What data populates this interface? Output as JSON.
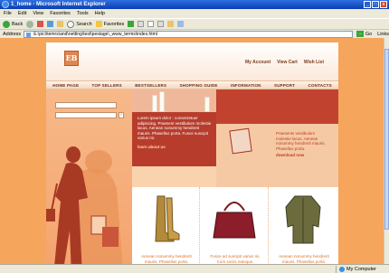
{
  "window": {
    "title": "1_home - Microsoft Internet Explorer",
    "controls": [
      "_",
      "□",
      "x"
    ]
  },
  "menubar": [
    "File",
    "Edit",
    "View",
    "Favorites",
    "Tools",
    "Help"
  ],
  "toolbar": {
    "back_label": "Back",
    "search_label": "Search",
    "favorites_label": "Favorites"
  },
  "address": {
    "label": "Address",
    "url": "E:\\pic\\itemrs\\and\\netting\\test\\pestage\\_www_terms\\index.html",
    "go_label": "Go",
    "links_label": "Links"
  },
  "status": {
    "left": "",
    "zone": "My Computer"
  },
  "site": {
    "logo": "EB",
    "toplinks": [
      "My Account",
      "View Cart",
      "Wish List"
    ],
    "nav": [
      "HOME PAGE",
      "TOP SELLERS",
      "BESTSELLERS",
      "SHOPPING GUIDE",
      "INFORMATION",
      "SUPPORT",
      "CONTACTS"
    ],
    "hero_text": "Lorem ipsum dolor : consectetuer adipiscing. Praesent vestibulum molestie lacus. Aenean nonummy hendrerit mauris. Phasellus porta. Fusce suscipit varius mi.",
    "hero_more": "learn about us",
    "side_text": "Praesents vestibulum molestie lacus. Aenean nonummy hendrerit mauris. Phasellus porta.",
    "side_more": "download now",
    "products": [
      {
        "caption": "Aenean nonummy hendrerit mauris. Phasellus porta."
      },
      {
        "caption": "Fusce ad suscipit varius mi. Cum sociis natoque."
      },
      {
        "caption": "Aenean nonummy hendrerit mauris. Phasellus porta."
      }
    ]
  },
  "colors": {
    "page_bg": "#f6a55c",
    "accent_red": "#b83c2c",
    "nav_text": "#6a2f14",
    "product_caption": "#d9722e"
  }
}
